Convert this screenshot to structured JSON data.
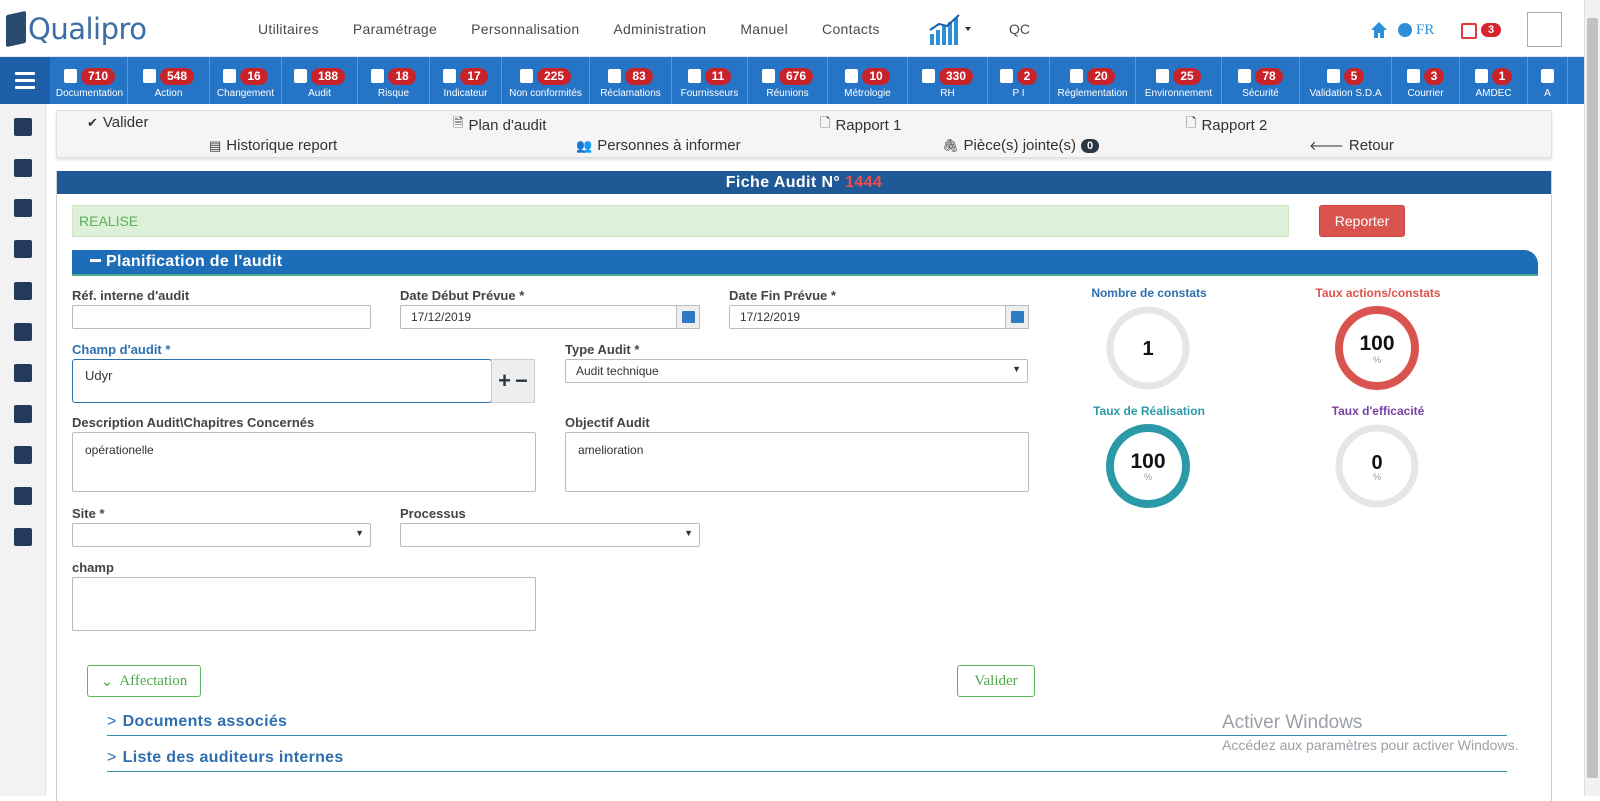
{
  "app": {
    "logo": "Qualipro"
  },
  "top_menu": [
    "Utilitaires",
    "Paramétrage",
    "Personnalisation",
    "Administration",
    "Manuel",
    "Contacts"
  ],
  "top_right": {
    "qc": "QC",
    "lang": "FR",
    "notif_count": "3"
  },
  "modules": [
    {
      "label": "Documentation",
      "count": "710"
    },
    {
      "label": "Action",
      "count": "548"
    },
    {
      "label": "Changement",
      "count": "16"
    },
    {
      "label": "Audit",
      "count": "188"
    },
    {
      "label": "Risque",
      "count": "18"
    },
    {
      "label": "Indicateur",
      "count": "17"
    },
    {
      "label": "Non conformités",
      "count": "225"
    },
    {
      "label": "Réclamations",
      "count": "83"
    },
    {
      "label": "Fournisseurs",
      "count": "11"
    },
    {
      "label": "Réunions",
      "count": "676"
    },
    {
      "label": "Métrologie",
      "count": "10"
    },
    {
      "label": "RH",
      "count": "330"
    },
    {
      "label": "P I",
      "count": "2"
    },
    {
      "label": "Réglementation",
      "count": "20"
    },
    {
      "label": "Environnement",
      "count": "25"
    },
    {
      "label": "Sécurité",
      "count": "78"
    },
    {
      "label": "Validation S.D.A",
      "count": "5"
    },
    {
      "label": "Courrier",
      "count": "3"
    },
    {
      "label": "AMDEC",
      "count": "1"
    },
    {
      "label": "A",
      "count": ""
    }
  ],
  "actions": {
    "valider": "Valider",
    "plan_audit": "Plan d'audit",
    "rapport1": "Rapport 1",
    "rapport2": "Rapport 2",
    "historique": "Historique report",
    "personnes": "Personnes à informer",
    "pieces": "Pièce(s) jointe(s)",
    "pieces_count": "0",
    "retour": "Retour"
  },
  "fiche": {
    "title": "Fiche Audit N°",
    "number": "1444",
    "status": "REALISE",
    "reporter": "Reporter",
    "section": "Planification de l'audit"
  },
  "form": {
    "ref_label": "Réf. interne d'audit",
    "ref_value": "",
    "date_debut_label": "Date Début Prévue *",
    "date_debut_value": "17/12/2019",
    "date_fin_label": "Date Fin Prévue *",
    "date_fin_value": "17/12/2019",
    "champ_label": "Champ d'audit *",
    "champ_value": "Udyr",
    "type_label": "Type Audit *",
    "type_value": "Audit technique",
    "desc_label": "Description Audit\\Chapitres Concernés",
    "desc_value": "opérationelle",
    "objectif_label": "Objectif Audit",
    "objectif_value": "amelioration",
    "site_label": "Site *",
    "site_value": "",
    "processus_label": "Processus",
    "processus_value": "",
    "champ2_label": "champ",
    "champ2_value": ""
  },
  "stats": {
    "constats_label": "Nombre de constats",
    "constats_value": "1",
    "taux_actions_label": "Taux actions/constats",
    "taux_actions_value": "100",
    "taux_real_label": "Taux de Réalisation",
    "taux_real_value": "100",
    "taux_eff_label": "Taux d'efficacité",
    "taux_eff_value": "0",
    "pct": "%"
  },
  "bottom": {
    "affectation": "Affectation",
    "valider": "Valider",
    "docs": "Documents associés",
    "auditeurs": "Liste des auditeurs internes"
  },
  "watermark": {
    "line1": "Activer Windows",
    "line2": "Accédez aux paramètres pour activer Windows."
  },
  "colors": {
    "brand_blue": "#2674c6",
    "badge_red": "#c9232a",
    "gauge_red": "#d9534f",
    "gauge_teal": "#2a9aa8",
    "gauge_grey": "#e6e6e6",
    "success_green": "#5cb85c"
  }
}
